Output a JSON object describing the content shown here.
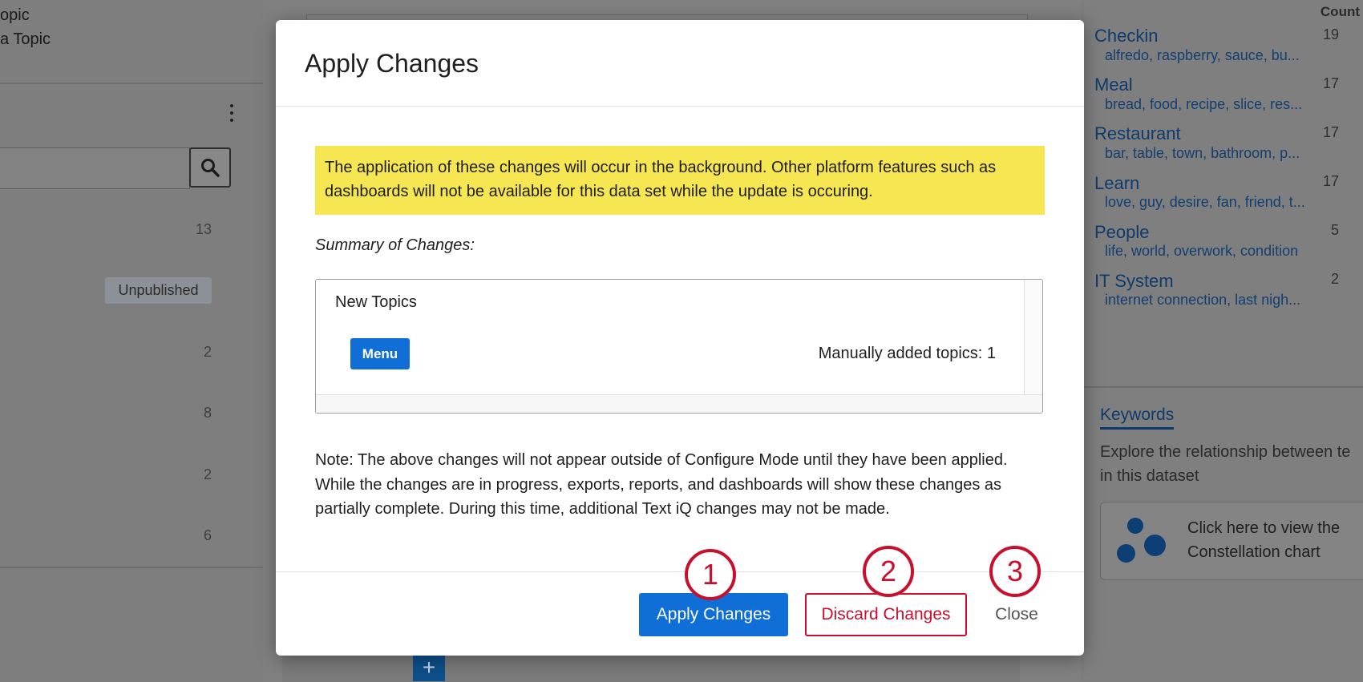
{
  "left_panel": {
    "line1": "opic",
    "line2": "a Topic",
    "unpublished_badge": "Unpublished",
    "counts": [
      "13",
      "2",
      "8",
      "2",
      "6"
    ]
  },
  "right_panel": {
    "count_header": "Count",
    "topics": [
      {
        "name": "Checkin",
        "keywords": "alfredo, raspberry, sauce, bu...",
        "count": "19"
      },
      {
        "name": "Meal",
        "keywords": "bread, food, recipe, slice, res...",
        "count": "17"
      },
      {
        "name": "Restaurant",
        "keywords": "bar, table, town, bathroom, p...",
        "count": "17"
      },
      {
        "name": "Learn",
        "keywords": "love, guy, desire, fan, friend, t...",
        "count": "17"
      },
      {
        "name": "People",
        "keywords": "life, world, overwork, condition",
        "count": "5"
      },
      {
        "name": "IT System",
        "keywords": "internet connection, last nigh...",
        "count": "2"
      }
    ],
    "keywords_tab": "Keywords",
    "keywords_desc": "Explore the relationship between te in this dataset",
    "constellation_text": "Click here to view the Constellation chart"
  },
  "modal": {
    "title": "Apply Changes",
    "warning": "The application of these changes will occur in the background. Other platform features such as dashboards will not be available for this data set while the update is occuring.",
    "summary_label": "Summary of Changes:",
    "summary": {
      "section_label": "New Topics",
      "menu_chip": "Menu",
      "manual_count": "Manually added topics: 1"
    },
    "note": "Note: The above changes will not appear outside of Configure Mode until they have been applied. While the changes are in progress, exports, reports, and dashboards will show these changes as partially complete. During this time, additional Text iQ changes may not be made.",
    "buttons": {
      "apply": "Apply Changes",
      "discard": "Discard Changes",
      "close": "Close"
    }
  },
  "steps": [
    "1",
    "2",
    "3"
  ],
  "middle": {
    "plus_button": "+"
  },
  "colors": {
    "primary": "#0f6fd6",
    "danger": "#c8102e",
    "warning_bg": "#f6e651"
  }
}
